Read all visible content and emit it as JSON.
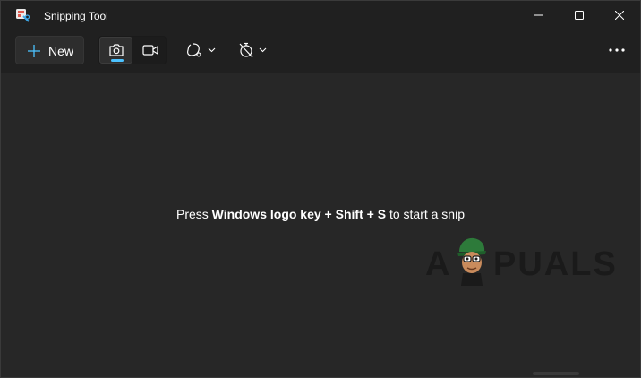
{
  "window": {
    "title": "Snipping Tool",
    "controls": [
      "minimize",
      "maximize",
      "close"
    ]
  },
  "toolbar": {
    "new_label": "New",
    "new_icon": "plus-icon",
    "modes": [
      {
        "name": "screenshot",
        "icon": "camera-icon",
        "selected": true
      },
      {
        "name": "record",
        "icon": "video-icon",
        "selected": false
      }
    ],
    "shape_icon": "snip-shape-icon",
    "delay_icon": "timer-off-icon",
    "more_icon": "more-icon"
  },
  "content": {
    "hint_pre": "Press ",
    "hint_key1": "Windows logo key",
    "hint_sep1": " + ",
    "hint_key2": "Shift",
    "hint_sep2": " + ",
    "hint_key3": "S",
    "hint_post": " to start a snip"
  },
  "watermark": {
    "text_left": "A",
    "text_right": "PUALS"
  },
  "colors": {
    "accent": "#4cc2ff",
    "background": "#272727",
    "titlebar": "#202020",
    "text": "#ffffff"
  }
}
